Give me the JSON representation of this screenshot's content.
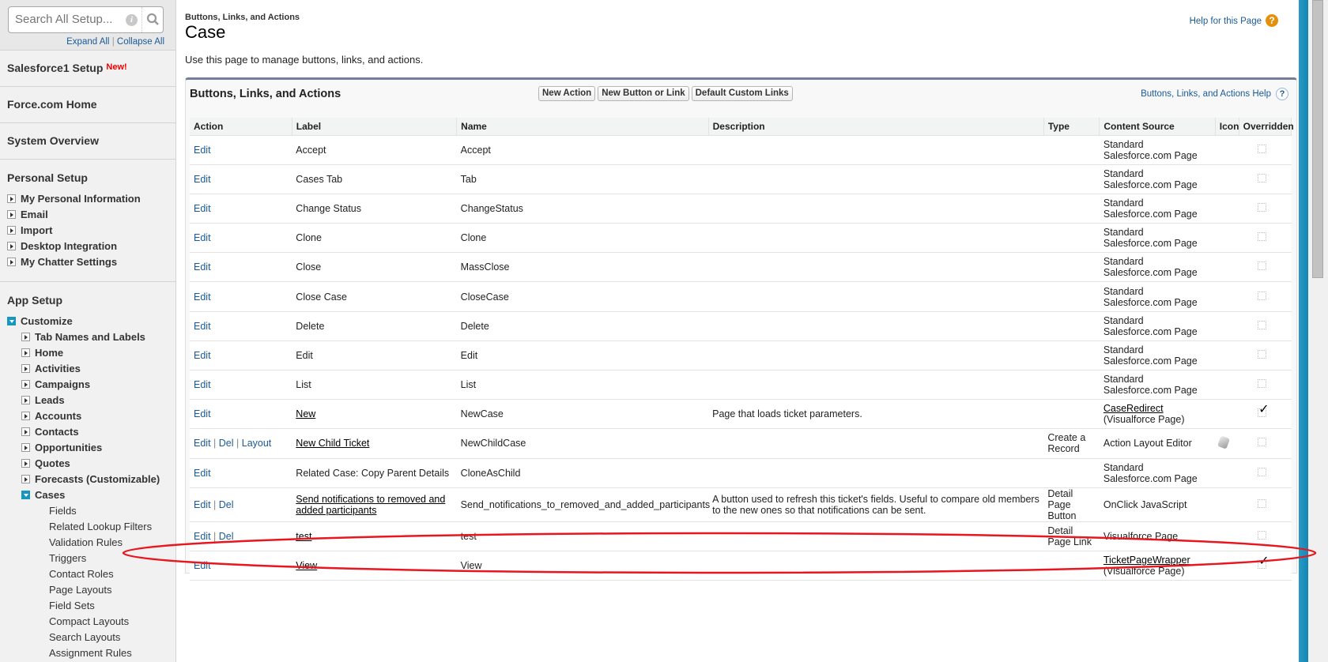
{
  "sidebar": {
    "search_placeholder": "Search All Setup...",
    "expand_all": "Expand All",
    "collapse_all": "Collapse All",
    "sep": "|",
    "salesforce1": "Salesforce1 Setup",
    "new_badge": "New!",
    "force_home": "Force.com Home",
    "system_overview": "System Overview",
    "personal_setup": "Personal Setup",
    "personal_items": [
      "My Personal Information",
      "Email",
      "Import",
      "Desktop Integration",
      "My Chatter Settings"
    ],
    "app_setup": "App Setup",
    "customize": "Customize",
    "customize_items": [
      "Tab Names and Labels",
      "Home",
      "Activities",
      "Campaigns",
      "Leads",
      "Accounts",
      "Contacts",
      "Opportunities",
      "Quotes",
      "Forecasts (Customizable)"
    ],
    "cases": "Cases",
    "cases_items": [
      "Fields",
      "Related Lookup Filters",
      "Validation Rules",
      "Triggers",
      "Contact Roles",
      "Page Layouts",
      "Field Sets",
      "Compact Layouts",
      "Search Layouts",
      "Assignment Rules"
    ]
  },
  "header": {
    "breadcrumb": "Buttons, Links, and Actions",
    "title": "Case",
    "help": "Help for this Page",
    "description": "Use this page to manage buttons, links, and actions."
  },
  "panel": {
    "title": "Buttons, Links, and Actions",
    "buttons": [
      "New Action",
      "New Button or Link",
      "Default Custom Links"
    ],
    "help": "Buttons, Links, and Actions Help",
    "columns": [
      "Action",
      "Label",
      "Name",
      "Description",
      "Type",
      "Content Source",
      "Icon",
      "Overridden"
    ],
    "rows": [
      {
        "actions": [
          "Edit"
        ],
        "label": "Accept",
        "link": false,
        "name": "Accept",
        "description": "",
        "type": "",
        "source": "Standard Salesforce.com Page",
        "source_sub": "",
        "icon": false,
        "overridden": false
      },
      {
        "actions": [
          "Edit"
        ],
        "label": "Cases Tab",
        "link": false,
        "name": "Tab",
        "description": "",
        "type": "",
        "source": "Standard Salesforce.com Page",
        "source_sub": "",
        "icon": false,
        "overridden": false
      },
      {
        "actions": [
          "Edit"
        ],
        "label": "Change Status",
        "link": false,
        "name": "ChangeStatus",
        "description": "",
        "type": "",
        "source": "Standard Salesforce.com Page",
        "source_sub": "",
        "icon": false,
        "overridden": false
      },
      {
        "actions": [
          "Edit"
        ],
        "label": "Clone",
        "link": false,
        "name": "Clone",
        "description": "",
        "type": "",
        "source": "Standard Salesforce.com Page",
        "source_sub": "",
        "icon": false,
        "overridden": false
      },
      {
        "actions": [
          "Edit"
        ],
        "label": "Close",
        "link": false,
        "name": "MassClose",
        "description": "",
        "type": "",
        "source": "Standard Salesforce.com Page",
        "source_sub": "",
        "icon": false,
        "overridden": false
      },
      {
        "actions": [
          "Edit"
        ],
        "label": "Close Case",
        "link": false,
        "name": "CloseCase",
        "description": "",
        "type": "",
        "source": "Standard Salesforce.com Page",
        "source_sub": "",
        "icon": false,
        "overridden": false
      },
      {
        "actions": [
          "Edit"
        ],
        "label": "Delete",
        "link": false,
        "name": "Delete",
        "description": "",
        "type": "",
        "source": "Standard Salesforce.com Page",
        "source_sub": "",
        "icon": false,
        "overridden": false
      },
      {
        "actions": [
          "Edit"
        ],
        "label": "Edit",
        "link": false,
        "name": "Edit",
        "description": "",
        "type": "",
        "source": "Standard Salesforce.com Page",
        "source_sub": "",
        "icon": false,
        "overridden": false
      },
      {
        "actions": [
          "Edit"
        ],
        "label": "List",
        "link": false,
        "name": "List",
        "description": "",
        "type": "",
        "source": "Standard Salesforce.com Page",
        "source_sub": "",
        "icon": false,
        "overridden": false
      },
      {
        "actions": [
          "Edit"
        ],
        "label": "New",
        "link": true,
        "name": "NewCase",
        "description": "Page that loads ticket parameters.",
        "type": "",
        "source": "CaseRedirect",
        "source_link": true,
        "source_sub": "(Visualforce Page)",
        "icon": false,
        "overridden": true
      },
      {
        "actions": [
          "Edit",
          "Del",
          "Layout"
        ],
        "label": "New Child Ticket",
        "link": true,
        "name": "NewChildCase",
        "description": "",
        "type": "Create a Record",
        "source": "Action Layout Editor",
        "source_sub": "",
        "icon": true,
        "overridden": false
      },
      {
        "actions": [
          "Edit"
        ],
        "label": "Related Case: Copy Parent Details",
        "link": false,
        "name": "CloneAsChild",
        "description": "",
        "type": "",
        "source": "Standard Salesforce.com Page",
        "source_sub": "",
        "icon": false,
        "overridden": false
      },
      {
        "actions": [
          "Edit",
          "Del"
        ],
        "label": "Send notifications to removed and added participants",
        "link": true,
        "name": "Send_notifications_to_removed_and_added_participants",
        "description": "A button used to refresh this ticket's fields. Useful to compare old members to the new ones so that notifications can be sent.",
        "type": "Detail Page Button",
        "source": "OnClick JavaScript",
        "source_sub": "",
        "icon": false,
        "overridden": false
      },
      {
        "actions": [
          "Edit",
          "Del"
        ],
        "label": "test",
        "link": true,
        "name": "test",
        "description": "",
        "type": "Detail Page Link",
        "source": "Visualforce Page",
        "source_sub": "",
        "icon": false,
        "overridden": false
      },
      {
        "actions": [
          "Edit"
        ],
        "label": "View",
        "link": true,
        "name": "View",
        "description": "",
        "type": "",
        "source": "TicketPageWrapper",
        "source_link": true,
        "source_sub": "(Visualforce Page)",
        "icon": false,
        "overridden": true
      }
    ]
  },
  "colors": {
    "link": "#1a5a96",
    "highlight": "#e8161e",
    "accent": "#1797c0"
  }
}
